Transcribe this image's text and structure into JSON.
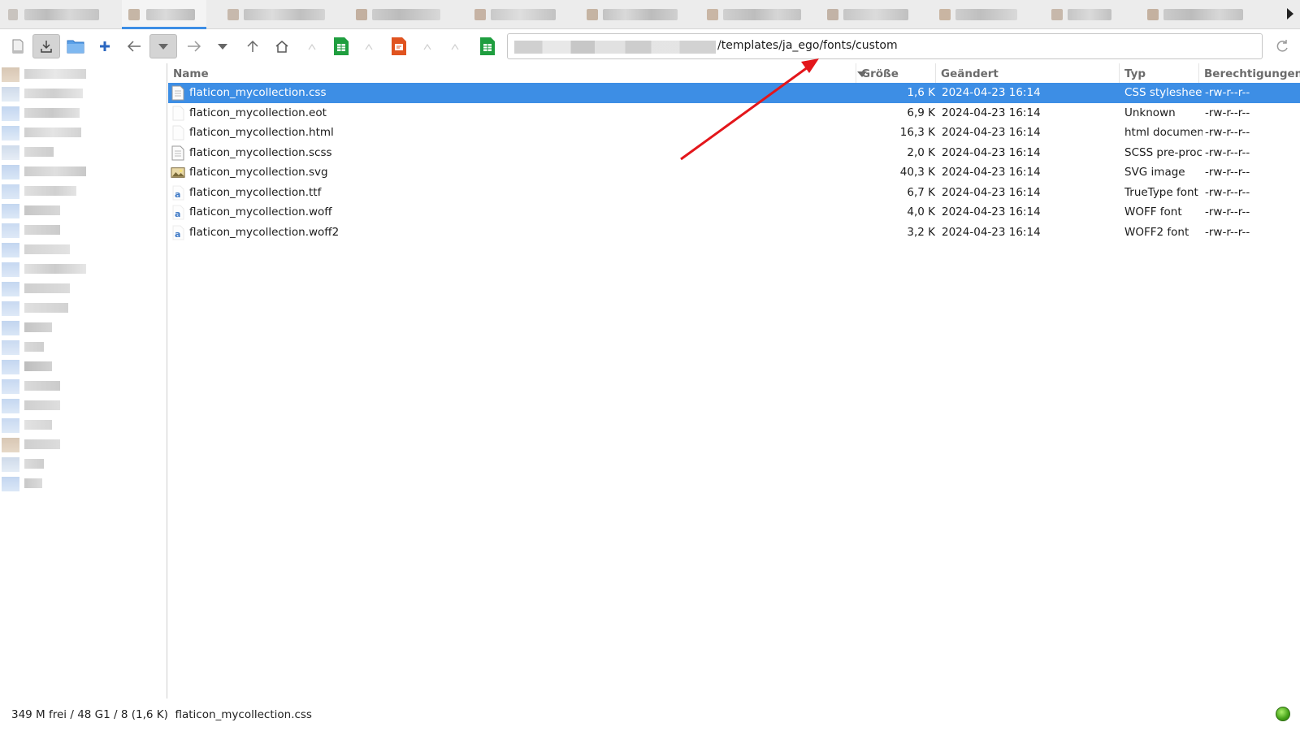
{
  "colors": {
    "accent": "#3d8ee5",
    "selection_text": "#ffffff",
    "annotation_arrow": "#e3161b",
    "status_ok": "#43a017"
  },
  "toolbar": {
    "buttons": [
      {
        "name": "new-tab-button",
        "icon": "document-icon"
      },
      {
        "name": "download-button",
        "icon": "download-icon"
      },
      {
        "name": "open-folder-button",
        "icon": "folder-icon"
      },
      {
        "name": "add-button",
        "icon": "plus-icon"
      },
      {
        "name": "back-button",
        "icon": "back-arrow-icon"
      },
      {
        "name": "back-history-button",
        "icon": "chevron-down-icon"
      },
      {
        "name": "forward-button",
        "icon": "forward-arrow-icon"
      },
      {
        "name": "forward-history-button",
        "icon": "chevron-down-icon"
      },
      {
        "name": "up-button",
        "icon": "up-arrow-icon"
      },
      {
        "name": "home-button",
        "icon": "home-icon"
      },
      {
        "name": "spreadsheet-app-button",
        "icon": "spreadsheet-icon"
      },
      {
        "name": "presentation-app-button",
        "icon": "presentation-icon"
      },
      {
        "name": "calc-app-button",
        "icon": "spreadsheet-icon"
      }
    ]
  },
  "address": {
    "path_visible": "/templates/ja_ego/fonts/custom"
  },
  "columns": {
    "name": "Name",
    "size": "Größe",
    "modified": "Geändert",
    "type": "Typ",
    "permissions": "Berechtigungen"
  },
  "files": [
    {
      "name": "flaticon_mycollection.css",
      "size": "1,6 K",
      "modified": "2024-04-23 16:14",
      "type": "CSS stylesheet",
      "permissions": "-rw-r--r--",
      "icon": "text-document-icon",
      "selected": true
    },
    {
      "name": "flaticon_mycollection.eot",
      "size": "6,9 K",
      "modified": "2024-04-23 16:14",
      "type": "Unknown",
      "permissions": "-rw-r--r--",
      "icon": "blank-file-icon",
      "selected": false
    },
    {
      "name": "flaticon_mycollection.html",
      "size": "16,3 K",
      "modified": "2024-04-23 16:14",
      "type": "html document",
      "permissions": "-rw-r--r--",
      "icon": "blank-file-icon",
      "selected": false
    },
    {
      "name": "flaticon_mycollection.scss",
      "size": "2,0 K",
      "modified": "2024-04-23 16:14",
      "type": "SCSS pre-processed",
      "permissions": "-rw-r--r--",
      "icon": "text-document-icon",
      "selected": false
    },
    {
      "name": "flaticon_mycollection.svg",
      "size": "40,3 K",
      "modified": "2024-04-23 16:14",
      "type": "SVG image",
      "permissions": "-rw-r--r--",
      "icon": "image-icon",
      "selected": false
    },
    {
      "name": "flaticon_mycollection.ttf",
      "size": "6,7 K",
      "modified": "2024-04-23 16:14",
      "type": "TrueType font",
      "permissions": "-rw-r--r--",
      "icon": "font-icon",
      "selected": false
    },
    {
      "name": "flaticon_mycollection.woff",
      "size": "4,0 K",
      "modified": "2024-04-23 16:14",
      "type": "WOFF font",
      "permissions": "-rw-r--r--",
      "icon": "font-icon",
      "selected": false
    },
    {
      "name": "flaticon_mycollection.woff2",
      "size": "3,2 K",
      "modified": "2024-04-23 16:14",
      "type": "WOFF2 font",
      "permissions": "-rw-r--r--",
      "icon": "font-icon",
      "selected": false
    }
  ],
  "status": {
    "summary": "349 M frei / 48 G1 / 8 (1,6 K)",
    "selected_file": "flaticon_mycollection.css"
  }
}
